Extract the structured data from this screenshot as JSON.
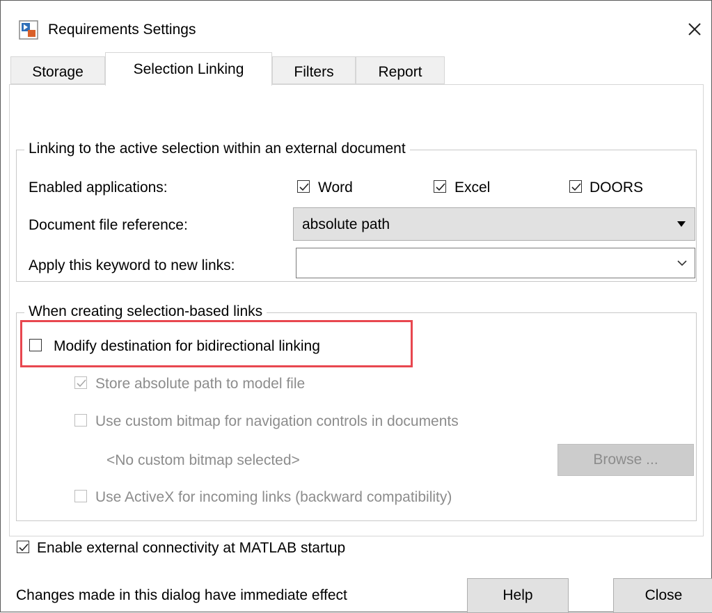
{
  "window": {
    "title": "Requirements Settings",
    "icon": "simulink-app-icon",
    "close_label": "close"
  },
  "tabs": [
    {
      "label": "Storage",
      "active": false
    },
    {
      "label": "Selection Linking",
      "active": true
    },
    {
      "label": "Filters",
      "active": false
    },
    {
      "label": "Report",
      "active": false
    }
  ],
  "linking_group": {
    "title": "Linking to the active selection within an external document",
    "enabled_apps_label": "Enabled applications:",
    "apps": [
      {
        "label": "Word",
        "checked": true
      },
      {
        "label": "Excel",
        "checked": true
      },
      {
        "label": "DOORS",
        "checked": true
      }
    ],
    "doc_ref_label": "Document file reference:",
    "doc_ref_value": "absolute path",
    "keyword_label": "Apply this keyword to new links:",
    "keyword_value": ""
  },
  "selection_group": {
    "title": "When creating selection-based links",
    "modify_dest_label": "Modify destination for bidirectional linking",
    "modify_dest_checked": false,
    "store_abs_path_label": "Store absolute path to model file",
    "store_abs_path_checked": true,
    "custom_bitmap_label": "Use custom bitmap for navigation controls in documents",
    "custom_bitmap_checked": false,
    "no_bitmap_text": "<No custom bitmap selected>",
    "browse_label": "Browse ...",
    "activex_label": "Use ActiveX for incoming links (backward compatibility)",
    "activex_checked": false
  },
  "startup": {
    "label": "Enable external connectivity at MATLAB startup",
    "checked": true
  },
  "footer": {
    "status_text": "Changes made in this dialog have immediate effect",
    "help_label": "Help",
    "close_label": "Close"
  },
  "colors": {
    "highlight": "#e8474f",
    "disabled_text": "#8c8c8c"
  }
}
